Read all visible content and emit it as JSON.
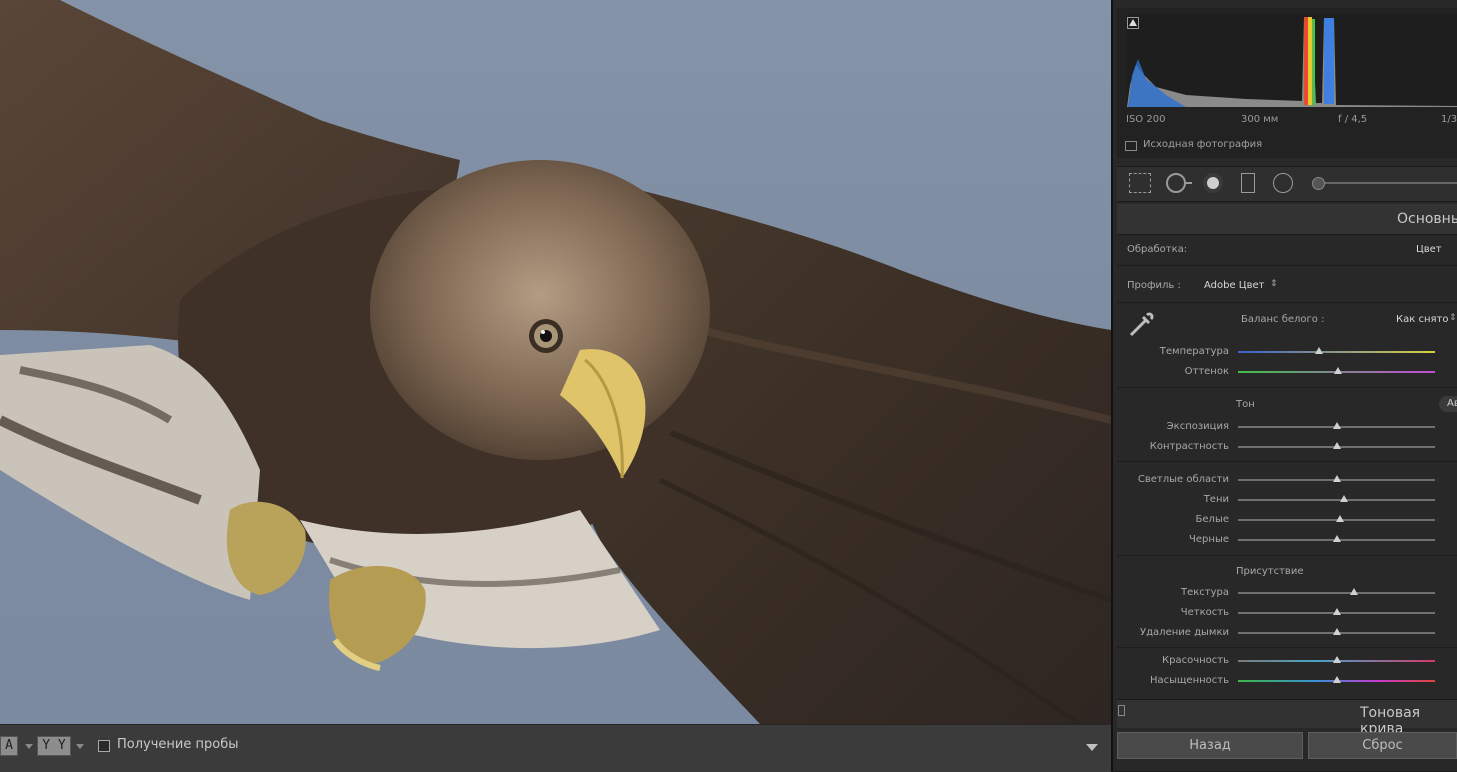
{
  "colors": {
    "sky": "#7f8da3",
    "panel": "#282828",
    "toolbar": "#3b3b3b",
    "accent_text": "#c9c9c9"
  },
  "toolbar": {
    "view_a_label": "A",
    "view_yy_label": "Y Y",
    "sample_label": "Получение пробы"
  },
  "histogram": {
    "iso": "ISO 200",
    "focal": "300 мм",
    "aperture": "f / 4,5",
    "shutter": "1/3",
    "original_label": "Исходная фотография"
  },
  "tools": [
    "crop-icon",
    "spot-removal-icon",
    "redeye-icon",
    "graduated-filter-icon",
    "radial-filter-icon"
  ],
  "basic": {
    "title": "Основны",
    "treatment_label": "Обработка:",
    "treatment_value": "Цвет",
    "profile_label": "Профиль :",
    "profile_value": "Adobe Цвет",
    "wb_label": "Баланс белого :",
    "wb_value": "Как снято",
    "tone_label": "Тон",
    "auto_label": "Ав",
    "presence_label": "Присутствие",
    "sliders": {
      "temperature": {
        "label": "Температура",
        "value": 0.41
      },
      "tint": {
        "label": "Оттенок",
        "value": 0.51
      },
      "exposure": {
        "label": "Экспозиция",
        "value": 0.5
      },
      "contrast": {
        "label": "Контрастность",
        "value": 0.5
      },
      "highlights": {
        "label": "Светлые области",
        "value": 0.5
      },
      "shadows": {
        "label": "Тени",
        "value": 0.54
      },
      "whites": {
        "label": "Белые",
        "value": 0.52
      },
      "blacks": {
        "label": "Черные",
        "value": 0.5
      },
      "texture": {
        "label": "Текстура",
        "value": 0.59
      },
      "clarity": {
        "label": "Четкость",
        "value": 0.5
      },
      "dehaze": {
        "label": "Удаление дымки",
        "value": 0.5
      },
      "vibrance": {
        "label": "Красочность",
        "value": 0.5
      },
      "saturation": {
        "label": "Насыщенность",
        "value": 0.5
      }
    }
  },
  "tone_curve": {
    "title": "Тоновая крива"
  },
  "buttons": {
    "back": "Назад",
    "reset": "Сброс"
  }
}
